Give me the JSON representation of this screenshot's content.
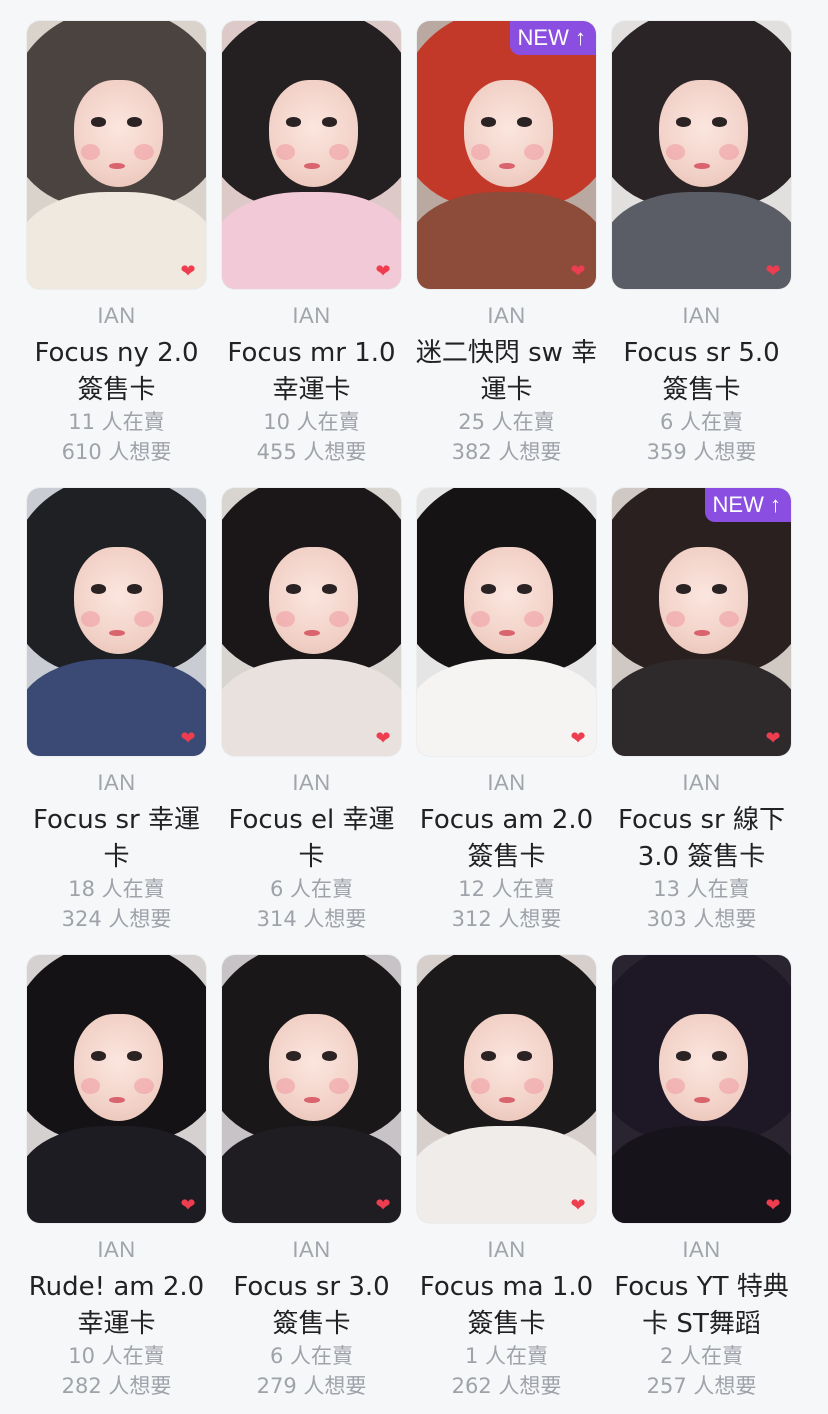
{
  "cards": [
    {
      "artist": "IAN",
      "name": "Focus ny 2.0 簽售卡",
      "selling": "11 人在賣",
      "wanting": "610 人想要",
      "new": "",
      "colors": {
        "bg": "#d9d3cb",
        "hair": "#4a4340",
        "body": "#efe9df"
      }
    },
    {
      "artist": "IAN",
      "name": "Focus mr 1.0 幸運卡",
      "selling": "10 人在賣",
      "wanting": "455 人想要",
      "new": "",
      "colors": {
        "bg": "#ddc9c8",
        "hair": "#241f21",
        "body": "#f2c9d6"
      }
    },
    {
      "artist": "IAN",
      "name": "迷二快閃 sw 幸運卡",
      "selling": "25 人在賣",
      "wanting": "382 人想要",
      "new": "NEW ↑",
      "colors": {
        "bg": "#b9a9a0",
        "hair": "#c2392a",
        "body": "#8d4b3a"
      }
    },
    {
      "artist": "IAN",
      "name": "Focus sr 5.0 簽售卡",
      "selling": "6 人在賣",
      "wanting": "359 人想要",
      "new": "",
      "colors": {
        "bg": "#e2e0de",
        "hair": "#2a2426",
        "body": "#5a5d66"
      }
    },
    {
      "artist": "IAN",
      "name": "Focus sr 幸運卡",
      "selling": "18 人在賣",
      "wanting": "324 人想要",
      "new": "",
      "colors": {
        "bg": "#c9ccd3",
        "hair": "#1f2024",
        "body": "#3b4a74"
      }
    },
    {
      "artist": "IAN",
      "name": "Focus el 幸運卡",
      "selling": "6 人在賣",
      "wanting": "314 人想要",
      "new": "",
      "colors": {
        "bg": "#d8d4d0",
        "hair": "#1b1718",
        "body": "#e8e1dd"
      }
    },
    {
      "artist": "IAN",
      "name": "Focus am 2.0 簽售卡",
      "selling": "12 人在賣",
      "wanting": "312 人想要",
      "new": "",
      "colors": {
        "bg": "#e5e5e6",
        "hair": "#151314",
        "body": "#f6f4f2"
      }
    },
    {
      "artist": "IAN",
      "name": "Focus sr 線下3.0 簽售卡",
      "selling": "13 人在賣",
      "wanting": "303 人想要",
      "new": "NEW ↑",
      "colors": {
        "bg": "#cfc8c3",
        "hair": "#2a2020",
        "body": "#2e2a2b"
      }
    },
    {
      "artist": "IAN",
      "name": "Rude! am 2.0 幸運卡",
      "selling": "10 人在賣",
      "wanting": "282 人想要",
      "new": "",
      "colors": {
        "bg": "#d6d1d1",
        "hair": "#141214",
        "body": "#1d1c22"
      }
    },
    {
      "artist": "IAN",
      "name": "Focus sr 3.0 簽售卡",
      "selling": "6 人在賣",
      "wanting": "279 人想要",
      "new": "",
      "colors": {
        "bg": "#c8c3c6",
        "hair": "#1a1719",
        "body": "#1f1d22"
      }
    },
    {
      "artist": "IAN",
      "name": "Focus ma 1.0 簽售卡",
      "selling": "1 人在賣",
      "wanting": "262 人想要",
      "new": "",
      "colors": {
        "bg": "#d7cfcc",
        "hair": "#1c191a",
        "body": "#f0ece9"
      }
    },
    {
      "artist": "IAN",
      "name": "Focus YT 特典卡 ST舞蹈",
      "selling": "2 人在賣",
      "wanting": "257 人想要",
      "new": "",
      "colors": {
        "bg": "#2a2430",
        "hair": "#1e1826",
        "body": "#16131a"
      }
    }
  ],
  "icons": {
    "favorite": "heart-icon",
    "badge": "new-badge"
  }
}
